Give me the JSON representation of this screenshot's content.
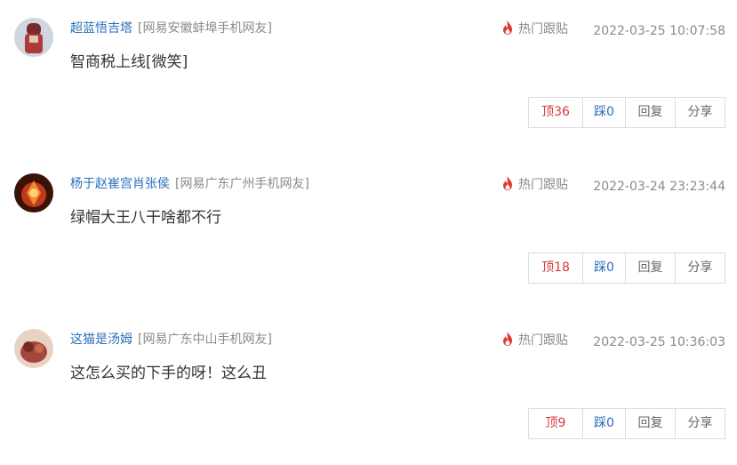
{
  "comments": [
    {
      "username": "超蓝悟吉塔",
      "location": "[网易安徽蚌埠手机网友]",
      "hot_label": "热门跟贴",
      "time": "2022-03-25 10:07:58",
      "content": "智商税上线[微笑]",
      "actions": {
        "up": "顶36",
        "down": "踩0",
        "reply": "回复",
        "share": "分享"
      },
      "avatar_color": "#b03a3a"
    },
    {
      "username": "杨于赵崔宫肖张侯",
      "location": "[网易广东广州手机网友]",
      "hot_label": "热门跟贴",
      "time": "2022-03-24 23:23:44",
      "content": "绿帽大王八干啥都不行",
      "actions": {
        "up": "顶18",
        "down": "踩0",
        "reply": "回复",
        "share": "分享"
      },
      "avatar_color": "#c0391e"
    },
    {
      "username": "这猫是汤姆",
      "location": "[网易广东中山手机网友]",
      "hot_label": "热门跟贴",
      "time": "2022-03-25 10:36:03",
      "content": "这怎么买的下手的呀！这么丑",
      "actions": {
        "up": "顶9",
        "down": "踩0",
        "reply": "回复",
        "share": "分享"
      },
      "avatar_color": "#a3473c"
    }
  ],
  "colors": {
    "username": "#2a6fb8",
    "muted": "#8a8a8a",
    "up": "#d7393f",
    "down": "#2a6fb8",
    "hot_icon": "#e03a2e"
  }
}
